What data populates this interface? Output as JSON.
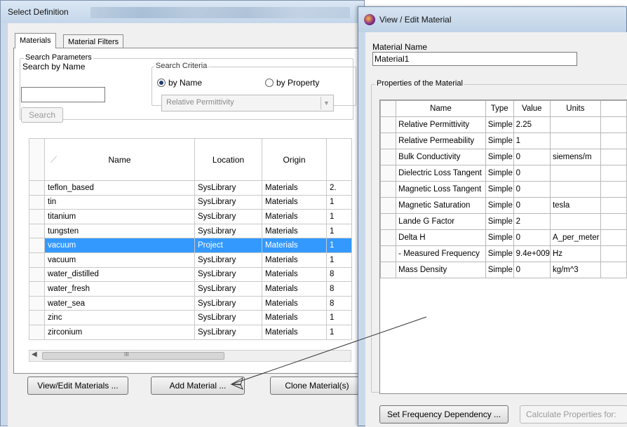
{
  "select_window": {
    "title": "Select Definition",
    "tabs": [
      {
        "label": "Materials"
      },
      {
        "label": "Material Filters"
      }
    ],
    "search_parameters": {
      "group_label": "Search Parameters",
      "search_by_name_label": "Search by Name",
      "search_value": "",
      "search_button": "Search",
      "criteria_group_label": "Search Criteria",
      "by_name_label": "by Name",
      "by_property_label": "by Property",
      "property_selected": "Relative Permittivity"
    },
    "table": {
      "columns": [
        "Name",
        "Location",
        "Origin"
      ],
      "rows": [
        {
          "name": "teflon_based",
          "location": "SysLibrary",
          "origin": "Materials",
          "extra": "2."
        },
        {
          "name": "tin",
          "location": "SysLibrary",
          "origin": "Materials",
          "extra": "1"
        },
        {
          "name": "titanium",
          "location": "SysLibrary",
          "origin": "Materials",
          "extra": "1"
        },
        {
          "name": "tungsten",
          "location": "SysLibrary",
          "origin": "Materials",
          "extra": "1"
        },
        {
          "name": "vacuum",
          "location": "Project",
          "origin": "Materials",
          "extra": "1"
        },
        {
          "name": "vacuum",
          "location": "SysLibrary",
          "origin": "Materials",
          "extra": "1"
        },
        {
          "name": "water_distilled",
          "location": "SysLibrary",
          "origin": "Materials",
          "extra": "8"
        },
        {
          "name": "water_fresh",
          "location": "SysLibrary",
          "origin": "Materials",
          "extra": "8"
        },
        {
          "name": "water_sea",
          "location": "SysLibrary",
          "origin": "Materials",
          "extra": "8"
        },
        {
          "name": "zinc",
          "location": "SysLibrary",
          "origin": "Materials",
          "extra": "1"
        },
        {
          "name": "zirconium",
          "location": "SysLibrary",
          "origin": "Materials",
          "extra": "1"
        }
      ]
    },
    "scroll_thumb_glyph": "III",
    "buttons": {
      "view_edit": "View/Edit Materials ...",
      "add_material": "Add Material ...",
      "clone": "Clone Material(s)"
    }
  },
  "view_window": {
    "title": "View / Edit Material",
    "material_name_label": "Material Name",
    "material_name_value": "Material1",
    "properties_group_label": "Properties of the Material",
    "columns": [
      "Name",
      "Type",
      "Value",
      "Units"
    ],
    "rows": [
      {
        "name": "Relative Permittivity",
        "type": "Simple",
        "value": "2.25",
        "units": ""
      },
      {
        "name": "Relative Permeability",
        "type": "Simple",
        "value": "1",
        "units": ""
      },
      {
        "name": "Bulk Conductivity",
        "type": "Simple",
        "value": "0",
        "units": "siemens/m"
      },
      {
        "name": "Dielectric Loss Tangent",
        "type": "Simple",
        "value": "0",
        "units": ""
      },
      {
        "name": "Magnetic Loss Tangent",
        "type": "Simple",
        "value": "0",
        "units": ""
      },
      {
        "name": "Magnetic Saturation",
        "type": "Simple",
        "value": "0",
        "units": "tesla"
      },
      {
        "name": "Lande G Factor",
        "type": "Simple",
        "value": "2",
        "units": ""
      },
      {
        "name": "Delta H",
        "type": "Simple",
        "value": "0",
        "units": "A_per_meter"
      },
      {
        "name": "- Measured Frequency",
        "type": "Simple",
        "value": "9.4e+009",
        "units": "Hz"
      },
      {
        "name": "Mass Density",
        "type": "Simple",
        "value": "0",
        "units": "kg/m^3"
      }
    ],
    "buttons": {
      "set_frequency": "Set Frequency Dependency ...",
      "calculate": "Calculate Properties for:"
    }
  },
  "colors": {
    "selection": "#3399ff",
    "window_frame": "#c9d9ea",
    "arrow": "#333333"
  }
}
